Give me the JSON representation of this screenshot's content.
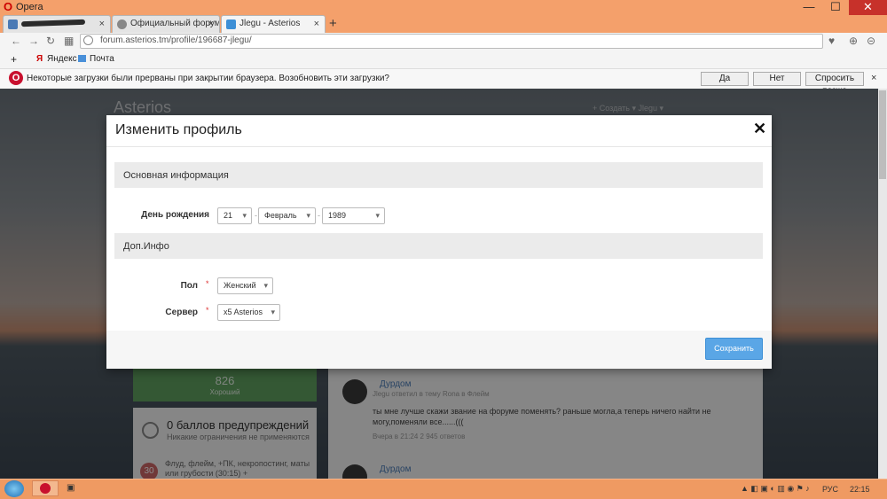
{
  "browser": {
    "app_name": "Opera",
    "tabs": [
      {
        "label": "",
        "redacted": true
      },
      {
        "label": "Официальный форум иг"
      },
      {
        "label": "Jlegu - Asterios",
        "active": true
      }
    ],
    "new_tab": "+",
    "address": "forum.asterios.tm/profile/196687-jlegu/",
    "bookmarks": [
      "Яндекс",
      "Почта"
    ],
    "bookmarks_add": "+",
    "infobar": {
      "message": "Некоторые загрузки были прерваны при закрытии браузера. Возобновить эти загрузки?",
      "buttons": {
        "yes": "Да",
        "no": "Нет",
        "later": "Спросить позже"
      },
      "close": "×"
    },
    "window_buttons": {
      "minimize": "—",
      "maximize": "☐",
      "close": "✕"
    }
  },
  "page_background": {
    "brand": "Asterios",
    "header_right": "+ Создать ▾        Jlegu ▾",
    "reputation_value": "826",
    "reputation_label": "Хороший",
    "warnings_title": "0 баллов предупреждений",
    "warnings_sub": "Никакие ограничения не применяются",
    "rule_badge": "30",
    "rule_text": "Флуд, флейм, +ПК, некропостинг, маты или грубости (30:15) +",
    "feed": [
      {
        "user": "Дурдом",
        "meta": "Jlegu ответил в тему Rona в Флейм",
        "message": "ты мне лучше скажи звание на форуме поменять? раньше могла,а теперь ничего найти не могу,поменяли все......(((",
        "footer": "Вчера в 21:24    2 945 ответов"
      },
      {
        "user": "Дурдом"
      }
    ]
  },
  "modal": {
    "title": "Изменить профиль",
    "close": "✕",
    "sections": [
      {
        "title": "Основная информация",
        "fields": [
          {
            "label": "День рождения",
            "values": {
              "day": "21",
              "month": "Февраль",
              "year": "1989"
            },
            "separator": "-"
          }
        ]
      },
      {
        "title": "Доп.Инфо",
        "fields": [
          {
            "label": "Пол",
            "required": "*",
            "value": "Женский"
          },
          {
            "label": "Сервер",
            "required": "*",
            "value": "x5 Asterios"
          }
        ]
      }
    ],
    "save_button": "Сохранить"
  },
  "taskbar": {
    "language": "РУС",
    "time": "22:15"
  },
  "colors": {
    "chrome_accent": "#f4a06b",
    "opera_red": "#c8102e",
    "save_button": "#5aa6e6",
    "reputation_green": "#5fa15f"
  }
}
